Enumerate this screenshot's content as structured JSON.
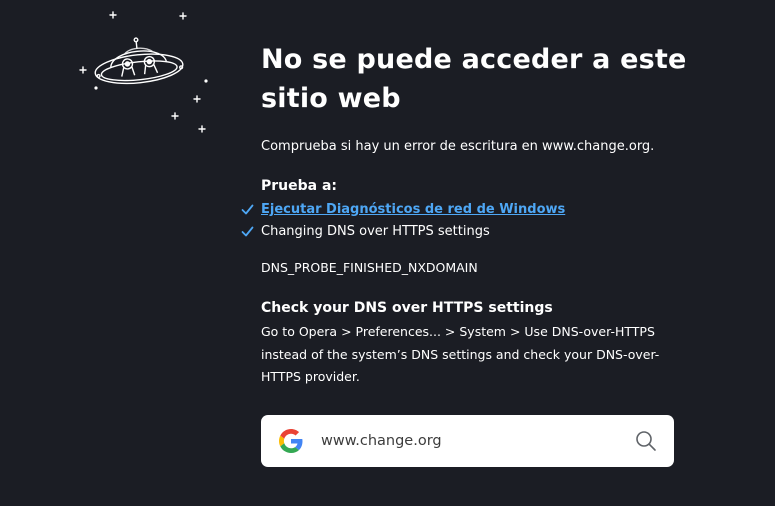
{
  "error_page": {
    "title": "No se puede acceder a este sitio web",
    "check_text": "Comprueba si hay un error de escritura en www.change.org.",
    "try_heading": "Prueba a:",
    "suggestions": [
      {
        "label": "Ejecutar Diagnósticos de red de Windows",
        "is_link": true
      },
      {
        "label": "Changing DNS over HTTPS settings",
        "is_link": false
      }
    ],
    "error_code": "DNS_PROBE_FINISHED_NXDOMAIN",
    "dns_heading": "Check your DNS over HTTPS settings",
    "dns_body": "Go to Opera > Preferences... > System > Use DNS-over-HTTPS instead of the system’s DNS settings and check your DNS-over-HTTPS provider."
  },
  "search": {
    "value": "www.change.org",
    "engine_icon": "google-g-icon",
    "action_icon": "search-icon"
  },
  "illustration": {
    "icon": "ufo-icon"
  },
  "colors": {
    "background": "#1b1d24",
    "text": "#ffffff",
    "link": "#4ea7f5",
    "check": "#4ea7f5"
  }
}
